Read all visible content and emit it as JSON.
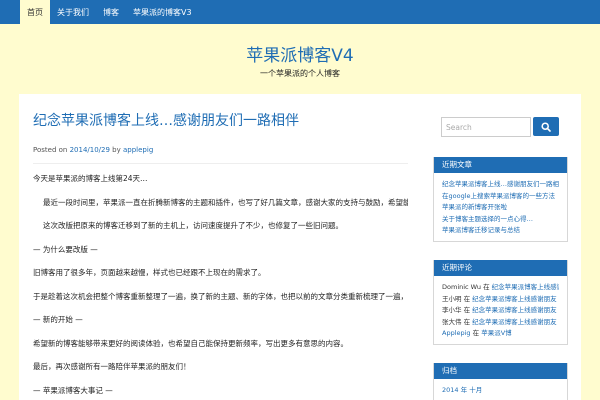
{
  "nav": {
    "items": [
      {
        "label": "首页"
      },
      {
        "label": "关于我们"
      },
      {
        "label": "博客"
      },
      {
        "label": "苹果派的博客V3"
      }
    ]
  },
  "site": {
    "title": "苹果派博客V4",
    "description": "一个苹果派的个人博客"
  },
  "post": {
    "title": "纪念苹果派博客上线…感谢朋友们一路相伴",
    "meta": {
      "prefix": "Posted on",
      "date": "2014/10/29",
      "by": "by",
      "author": "applepig"
    },
    "paragraphs": [
      "今天是苹果派的博客上线第24天…",
      "最近一段时间里，苹果派一直在折腾新博客的主题和插件，也写了好几篇文章，感谢大家的支持与鼓励，希望能够继续坚持下去。",
      "这次改版把原来的博客迁移到了新的主机上，访问速度提升了不少，也修复了一些旧问题。",
      "— 为什么要改版 —",
      "旧博客用了很多年，页面越来越慢，样式也已经跟不上现在的需求了。",
      "于是趁着这次机会把整个博客重新整理了一遍，换了新的主题、新的字体，也把以前的文章分类重新梳理了一遍，方便大家阅读和查找。",
      "— 新的开始 —",
      "希望新的博客能够带来更好的阅读体验，也希望自己能保持更新频率，写出更多有意思的内容。",
      "最后，再次感谢所有一路陪伴苹果派的朋友们！",
      "— 苹果派博客大事记 —"
    ]
  },
  "search": {
    "placeholder": "Search"
  },
  "widgets": {
    "recent_posts": {
      "title": "近期文章",
      "items": [
        "纪念苹果派博客上线…感谢朋友们一路相伴",
        "在google上搜索苹果派博客的一些方法",
        "苹果派的新博客开张啦",
        "关于博客主题选择的一点心得…",
        "苹果派博客迁移记录与总结"
      ]
    },
    "recent_comments": {
      "title": "近期评论",
      "items": [
        {
          "author": "Dominic Wu",
          "sep": "在",
          "post": "纪念苹果派博客上线感谢朋友们"
        },
        {
          "author": "王小明",
          "sep": "在",
          "post": "纪念苹果派博客上线感谢朋友"
        },
        {
          "author": "李小华",
          "sep": "在",
          "post": "纪念苹果派博客上线感谢朋友"
        },
        {
          "author": "张大伟",
          "sep": "在",
          "post": "纪念苹果派博客上线感谢朋友"
        },
        {
          "author": "Applepig",
          "sep": "在",
          "post": "苹果派V博"
        }
      ]
    },
    "archives": {
      "title": "归档",
      "items": [
        {
          "year": "2014",
          "sep": "年",
          "month": "十月"
        }
      ]
    }
  },
  "colors": {
    "accent": "#1f6db4",
    "background": "#fffccf",
    "card": "#ffffff"
  }
}
